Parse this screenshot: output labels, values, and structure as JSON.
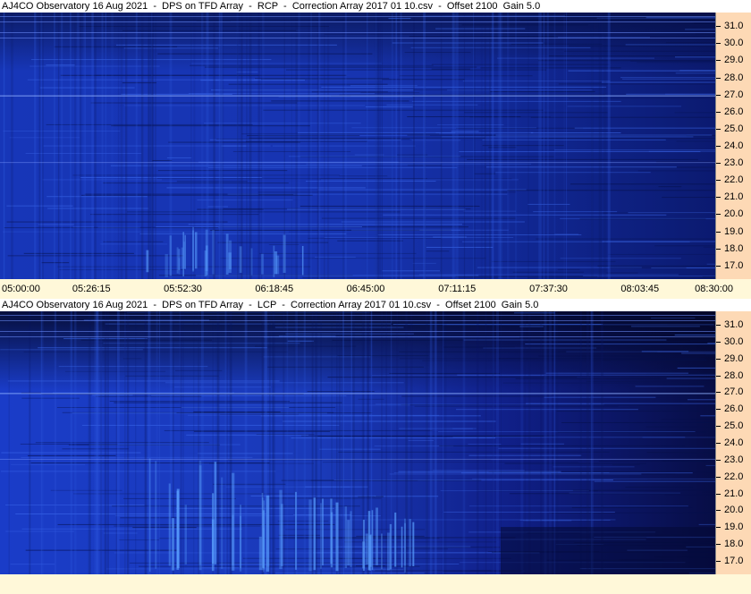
{
  "chart_data": [
    {
      "type": "heatmap",
      "title": "AJ4CO Observatory 16 Aug 2021  -  DPS on TFD Array  -  RCP  -  Correction Array 2017 01 10.csv  -  Offset 2100  Gain 5.0",
      "y_ticks": [
        "31.0",
        "30.0",
        "29.0",
        "28.0",
        "27.0",
        "26.0",
        "25.0",
        "24.0",
        "23.0",
        "22.0",
        "21.0",
        "20.0",
        "19.0",
        "18.0",
        "17.0"
      ],
      "ylim": [
        16.2,
        31.8
      ],
      "x_ticks": [
        "05:00:00",
        "05:26:15",
        "05:52:30",
        "06:18:45",
        "06:45:00",
        "07:11:15",
        "07:37:30",
        "08:03:45",
        "08:30:00"
      ],
      "colors": {
        "low": "#050a3c",
        "mid": "#1530a8",
        "high": "#3d7aff"
      }
    },
    {
      "type": "heatmap",
      "title": "AJ4CO Observatory 16 Aug 2021  -  DPS on TFD Array  -  LCP  -  Correction Array 2017 01 10.csv  -  Offset 2100  Gain 5.0",
      "y_ticks": [
        "31.0",
        "30.0",
        "29.0",
        "28.0",
        "27.0",
        "26.0",
        "25.0",
        "24.0",
        "23.0",
        "22.0",
        "21.0",
        "20.0",
        "19.0",
        "18.0",
        "17.0"
      ],
      "ylim": [
        16.2,
        31.8
      ]
    }
  ]
}
